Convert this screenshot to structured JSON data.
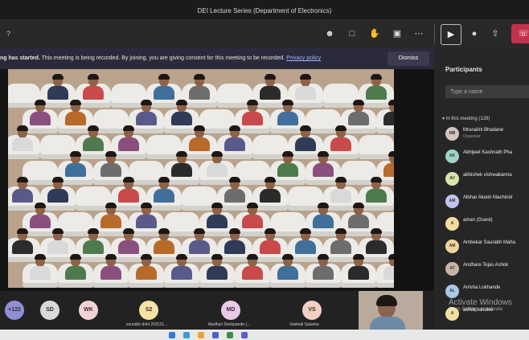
{
  "window": {
    "title": "DEI Lecture Series (Department of Electronics)"
  },
  "controls": {
    "duration": "?",
    "icons": [
      "participants-icon",
      "chat-icon",
      "raise-hand-icon",
      "rooms-icon",
      "more-icon"
    ],
    "camera_icon": "camera-icon",
    "mic_icon": "mic-icon",
    "share_icon": "share-icon",
    "leave_icon": "hang-up-icon"
  },
  "banner": {
    "strong": "ng has started.",
    "text": " This meeting is being recorded. By joining, you are giving consent for this meeting to be recorded.",
    "link": "Privacy policy",
    "dismiss_label": "Dismiss"
  },
  "gallery": {
    "participants": [
      {
        "initials": "+122",
        "name": "",
        "color": "#8f8fd6"
      },
      {
        "initials": "SD",
        "name": "",
        "color": "#d9d9d9"
      },
      {
        "initials": "WK",
        "name": "",
        "color": "#f2d2d2"
      },
      {
        "initials": "S2",
        "name": "sourabh dohi 203121...",
        "color": "#f4e3a4"
      },
      {
        "initials": "MD",
        "name": "Madhuri Deshpande (...",
        "color": "#e9cbe9"
      },
      {
        "initials": "VS",
        "name": "Vaishali Salunke",
        "color": "#f3cfc4"
      }
    ]
  },
  "participants": {
    "title": "Participants",
    "search_placeholder": "Type a name",
    "in_meeting": "In this meeting (128)",
    "list": [
      {
        "initials": "MB",
        "name": "Mrunalini Bhadane",
        "sub": "Organizer",
        "color": "#d5c4c0"
      },
      {
        "initials": "AK",
        "name": "Abhijeet Kashnath Pha",
        "sub": "",
        "color": "#9fd3c6"
      },
      {
        "initials": "AV",
        "name": "abhishek vishwakarma",
        "sub": "",
        "color": "#d7e6a8"
      },
      {
        "initials": "AM",
        "name": "Albhar Akash Machindr",
        "sub": "",
        "color": "#c3c3ee"
      },
      {
        "initials": "A",
        "name": "aman (Guest)",
        "sub": "",
        "color": "#f3dda0"
      },
      {
        "initials": "AM",
        "name": "Ambekar Saurabh Maha",
        "sub": "",
        "color": "#efd59c"
      },
      {
        "initials": "AT",
        "name": "Andhare Tejas Ashok",
        "sub": "",
        "color": "#c9b3a8"
      },
      {
        "initials": "AL",
        "name": "Anisha Lokhande",
        "sub": "",
        "color": "#a9c8e8"
      },
      {
        "initials": "A",
        "name": "ashok.randive",
        "sub": "",
        "color": "#f0e0a0"
      }
    ]
  },
  "watermark": {
    "line1": "Activate Windows",
    "line2": "Go to Settings to activate"
  },
  "colors": {
    "leave": "#c4314b",
    "banner_link": "#a9b2ff",
    "panel_bg": "#262626"
  }
}
